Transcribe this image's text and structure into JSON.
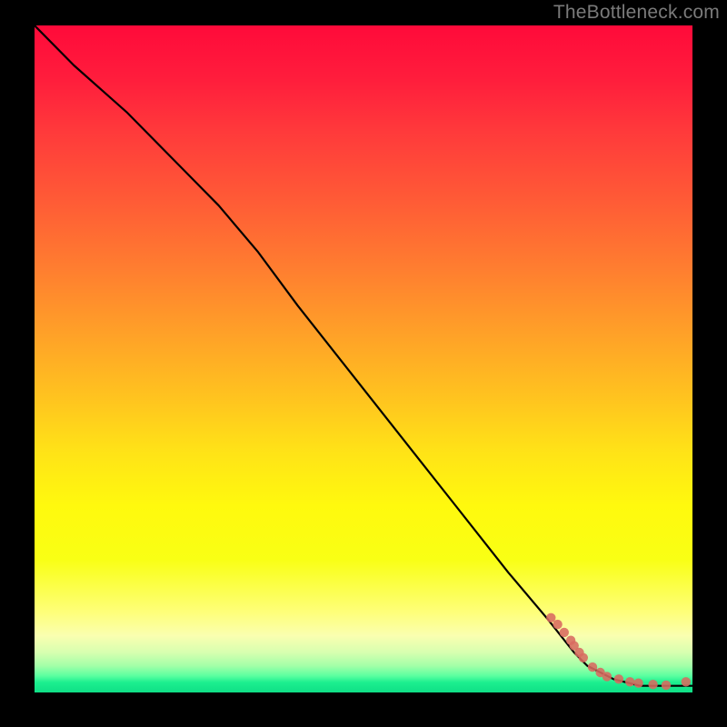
{
  "watermark": "TheBottleneck.com",
  "chart_data": {
    "type": "line",
    "title": "",
    "xlabel": "",
    "ylabel": "",
    "xlim": [
      0,
      100
    ],
    "ylim": [
      0,
      100
    ],
    "grid": false,
    "legend": false,
    "series": [
      {
        "name": "curve",
        "kind": "line",
        "x": [
          0,
          6,
          14,
          22,
          28,
          34,
          40,
          48,
          56,
          64,
          72,
          78,
          82,
          84,
          88,
          92,
          96,
          100
        ],
        "y": [
          100,
          94,
          87,
          79,
          73,
          66,
          58,
          48,
          38,
          28,
          18,
          11,
          6,
          4,
          2,
          1,
          1,
          1
        ]
      },
      {
        "name": "markers",
        "kind": "scatter",
        "x": [
          78.5,
          79.5,
          80.5,
          81.5,
          82.0,
          82.8,
          83.4,
          84.8,
          86.0,
          87.0,
          88.8,
          90.5,
          91.8,
          94.0,
          96.0,
          99.0
        ],
        "y": [
          11.2,
          10.2,
          9.0,
          7.8,
          7.0,
          6.0,
          5.2,
          3.8,
          3.0,
          2.4,
          2.0,
          1.6,
          1.4,
          1.2,
          1.1,
          1.6
        ]
      }
    ],
    "background_gradient": {
      "top_color": "#ff0a3a",
      "mid_color": "#fff90e",
      "bottom_color": "#0fdf86"
    }
  }
}
